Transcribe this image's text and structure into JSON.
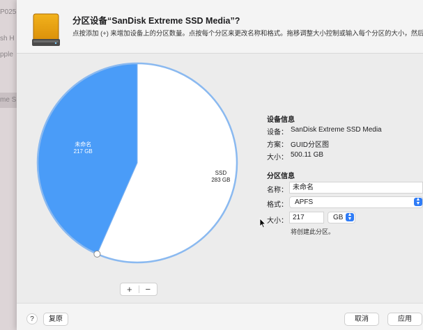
{
  "background_window": {
    "fragments": [
      "P025",
      "sh H",
      "pple",
      "me S"
    ]
  },
  "dialog": {
    "title": "分区设备“SanDisk Extreme SSD Media”?",
    "subtitle": "点按添加 (+) 来增加设备上的分区数量。点按每个分区来更改名称和格式。拖移调整大小控制或输入每个分区的大小，然后点按“应用”。",
    "drive_icon": "external-drive-icon"
  },
  "pie": {
    "partitions": [
      {
        "name": "未命名",
        "size": "217 GB",
        "value": 217,
        "color": "#4a9cf8",
        "selected": true
      },
      {
        "name": "SSD",
        "size": "283 GB",
        "value": 283,
        "color": "#ffffff",
        "selected": false
      }
    ],
    "add_label": "+",
    "remove_label": "−"
  },
  "device_info": {
    "section_title": "设备信息",
    "rows": [
      {
        "label": "设备：",
        "value": "SanDisk Extreme SSD Media"
      },
      {
        "label": "方案：",
        "value": "GUID分区图"
      },
      {
        "label": "大小：",
        "value": "500.11 GB"
      }
    ]
  },
  "partition_info": {
    "section_title": "分区信息",
    "name_label": "名称：",
    "name_value": "未命名",
    "format_label": "格式：",
    "format_value": "APFS",
    "size_label": "大小：",
    "size_value": "217",
    "size_unit": "GB",
    "hint": "将创建此分区。"
  },
  "footer": {
    "help_label": "?",
    "revert_label": "复原",
    "cancel_label": "取消",
    "apply_label": "应用"
  }
}
